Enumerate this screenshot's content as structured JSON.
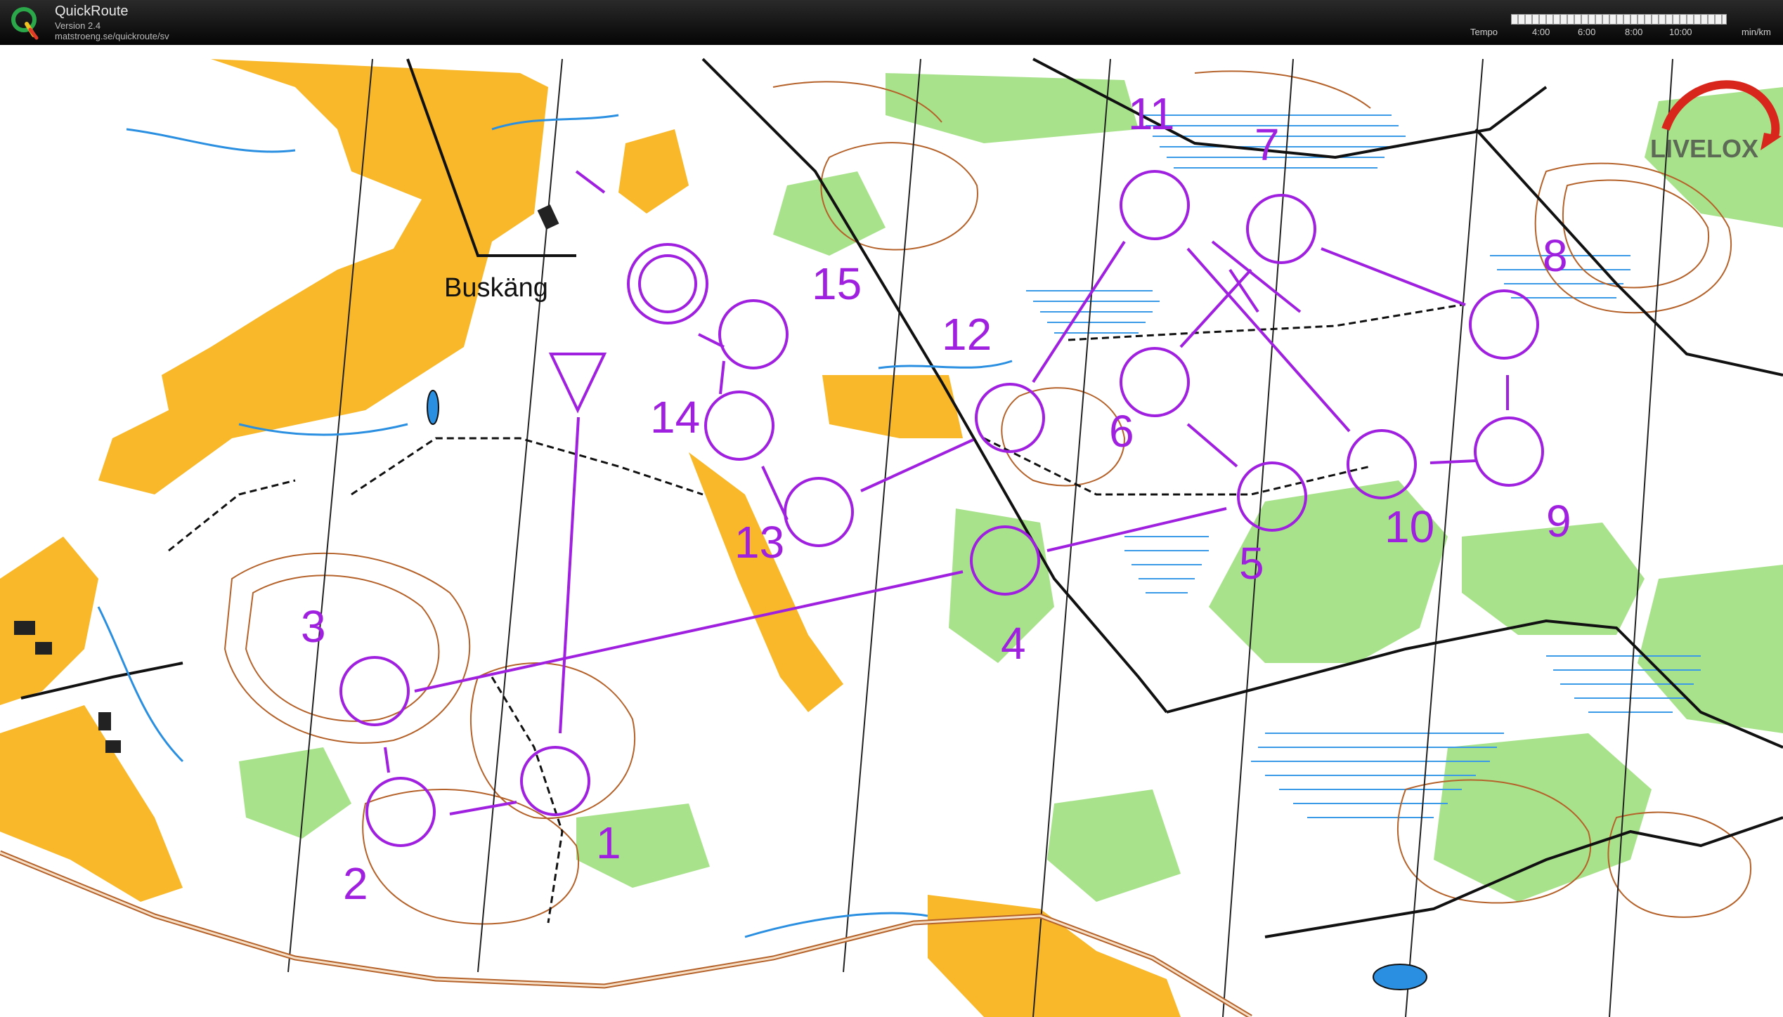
{
  "app": {
    "title": "QuickRoute",
    "version": "Version 2.4",
    "url": "matstroeng.se/quickroute/sv"
  },
  "tempo_scale": {
    "label": "Tempo",
    "ticks": [
      "4:00",
      "6:00",
      "8:00",
      "10:00"
    ],
    "unit": "min/km"
  },
  "map": {
    "place_name": "Buskäng",
    "watermark": "LIVELOX",
    "course_color": "#a020e0",
    "colors": {
      "open_land": "#f8b82a",
      "forest_green": "#86d36a",
      "marsh_blue": "#2a8fe0",
      "contour_brown": "#b5622a",
      "road_black": "#111111"
    },
    "controls": [
      {
        "label": "1"
      },
      {
        "label": "2"
      },
      {
        "label": "3"
      },
      {
        "label": "4"
      },
      {
        "label": "5"
      },
      {
        "label": "6"
      },
      {
        "label": "7"
      },
      {
        "label": "8"
      },
      {
        "label": "9"
      },
      {
        "label": "10"
      },
      {
        "label": "11"
      },
      {
        "label": "12"
      },
      {
        "label": "13"
      },
      {
        "label": "14"
      },
      {
        "label": "15"
      }
    ]
  }
}
